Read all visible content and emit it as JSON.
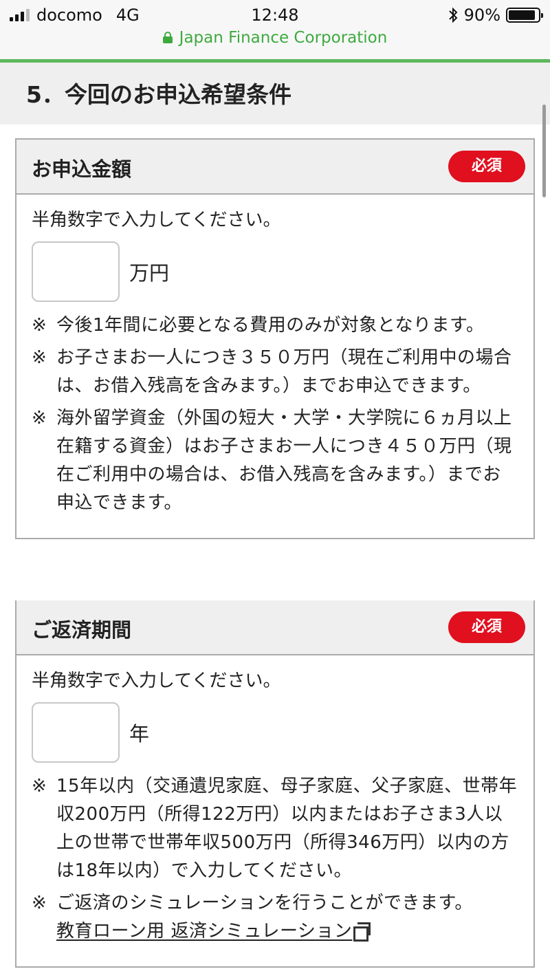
{
  "status_bar": {
    "carrier": "docomo",
    "network": "4G",
    "time": "12:48",
    "battery_percent": "90%",
    "battery_level": 0.9,
    "site_name": "Japan Finance Corporation"
  },
  "section": {
    "title": "5．今回のお申込希望条件"
  },
  "amount_field": {
    "label": "お申込金額",
    "required": "必須",
    "hint": "半角数字で入力してください。",
    "value": "",
    "unit": "万円",
    "notes": [
      {
        "mark": "※",
        "text": "今後1年間に必要となる費用のみが対象となります。"
      },
      {
        "mark": "※",
        "text": "お子さまお一人につき３５０万円（現在ご利用中の場合は、お借入残高を含みます。）までお申込できます。"
      },
      {
        "mark": "※",
        "text": "海外留学資金（外国の短大・大学・大学院に６ヵ月以上在籍する資金）はお子さまお一人につき４５０万円（現在ご利用中の場合は、お借入残高を含みます。）までお申込できます。"
      }
    ]
  },
  "repayment_field": {
    "label": "ご返済期間",
    "required": "必須",
    "hint": "半角数字で入力してください。",
    "value": "",
    "unit": "年",
    "notes": [
      {
        "mark": "※",
        "text": "15年以内（交通遺児家庭、母子家庭、父子家庭、世帯年収200万円（所得122万円）以内またはお子さま3人以上の世帯で世帯年収500万円（所得346万円）以内の方は18年以内）で入力してください。"
      },
      {
        "mark": "※",
        "text": "ご返済のシミュレーションを行うことができます。"
      }
    ],
    "simulation_link": "教育ローン用 返済シミュレーション"
  }
}
